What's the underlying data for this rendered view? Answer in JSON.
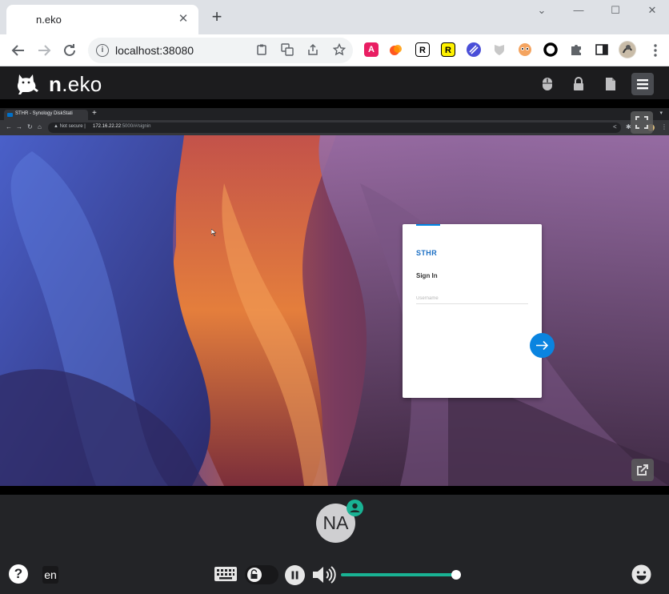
{
  "browser": {
    "tab_title": "n.eko",
    "tab_close": "✕",
    "new_tab": "+",
    "url": "localhost:38080",
    "window_controls": [
      "⌄",
      "—",
      "☐",
      "✕"
    ]
  },
  "neko": {
    "logo_prefix": "n",
    "logo_suffix": ".eko",
    "accent_color": "#19b394",
    "remote": {
      "tab_title": "STHR - Synology DiskStati",
      "new_tab": "+",
      "security_label": "Not secure",
      "url_host": "172.16.22.22",
      "url_path": ":5000/#/signin",
      "signin": {
        "brand": "STHR",
        "heading": "Sign In",
        "username_placeholder": "Username"
      }
    },
    "member": {
      "initials": "NA"
    },
    "language": "en",
    "volume_percent": 100
  }
}
